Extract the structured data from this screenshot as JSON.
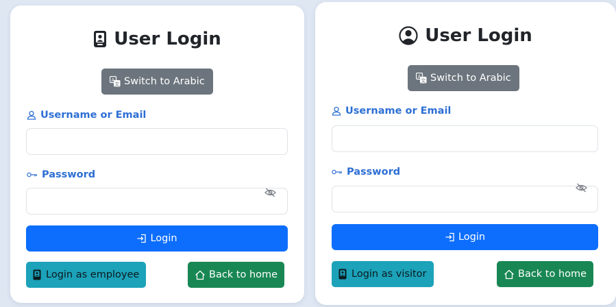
{
  "left_card": {
    "title": "User Login",
    "switch_label": "Switch to Arabic",
    "username_label": "Username or Email",
    "username_value": "",
    "password_label": "Password",
    "password_value": "",
    "login_label": "Login",
    "alt_login_label": "Login as employee",
    "home_label": "Back to home"
  },
  "right_card": {
    "title": "User Login",
    "switch_label": "Switch to Arabic",
    "username_label": "Username or Email",
    "username_value": "",
    "password_label": "Password",
    "password_value": "",
    "login_label": "Login",
    "alt_login_label": "Login as visitor",
    "home_label": "Back to home"
  },
  "icons": {
    "left_title": "badge-icon",
    "right_title": "user-circle-icon",
    "switch": "translate-icon",
    "username": "person-icon",
    "password": "key-icon",
    "toggle": "eye-slash-icon",
    "login": "box-arrow-in-icon",
    "alt_login": "badge-icon",
    "home": "house-icon"
  },
  "colors": {
    "background": "#dfe7f3",
    "card": "#ffffff",
    "label": "#2d6fd4",
    "switch_button": "#6c757d",
    "login_button": "#0d6efd",
    "alt_button": "#1ca2b9",
    "home_button": "#198754"
  }
}
